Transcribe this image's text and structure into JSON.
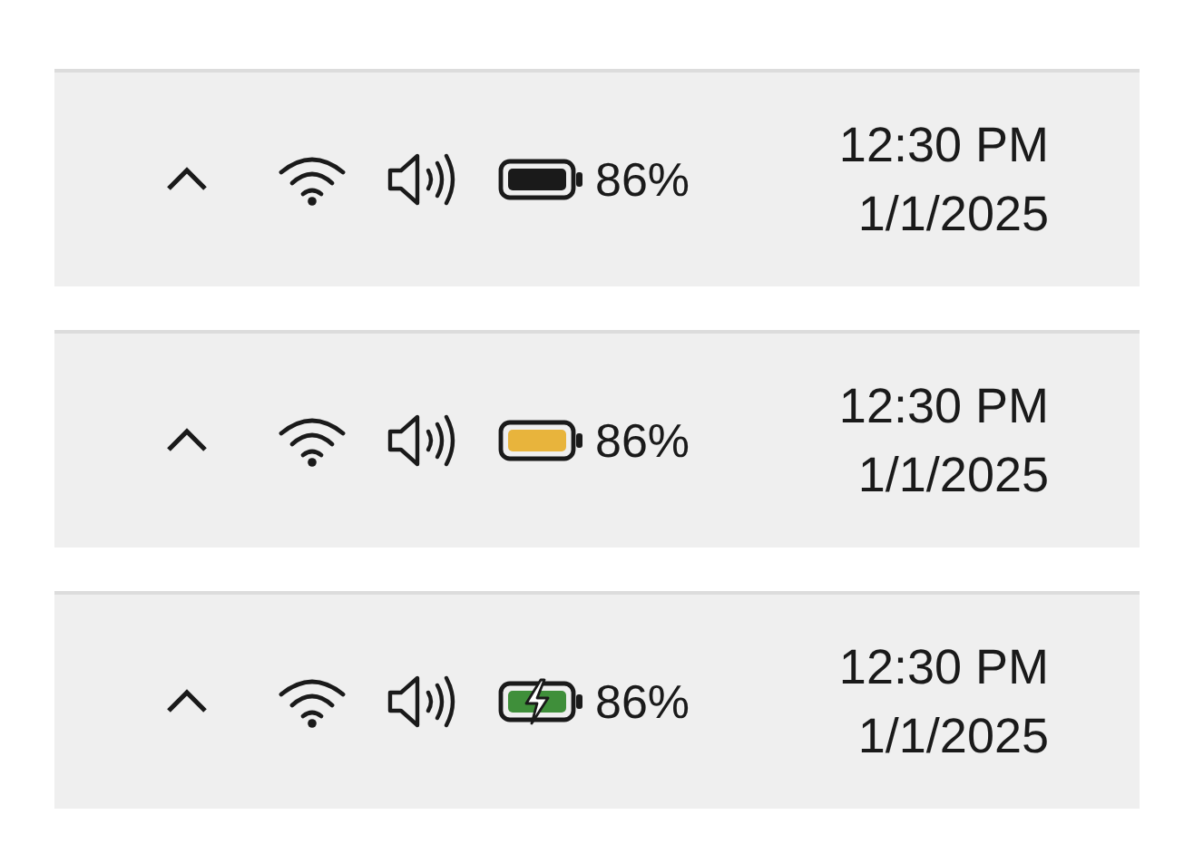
{
  "trays": [
    {
      "battery": {
        "kind": "normal"
      },
      "percent": "86%",
      "time": "12:30 PM",
      "date": "1/1/2025"
    },
    {
      "battery": {
        "kind": "saver"
      },
      "percent": "86%",
      "time": "12:30 PM",
      "date": "1/1/2025"
    },
    {
      "battery": {
        "kind": "charging"
      },
      "percent": "86%",
      "time": "12:30 PM",
      "date": "1/1/2025"
    }
  ]
}
